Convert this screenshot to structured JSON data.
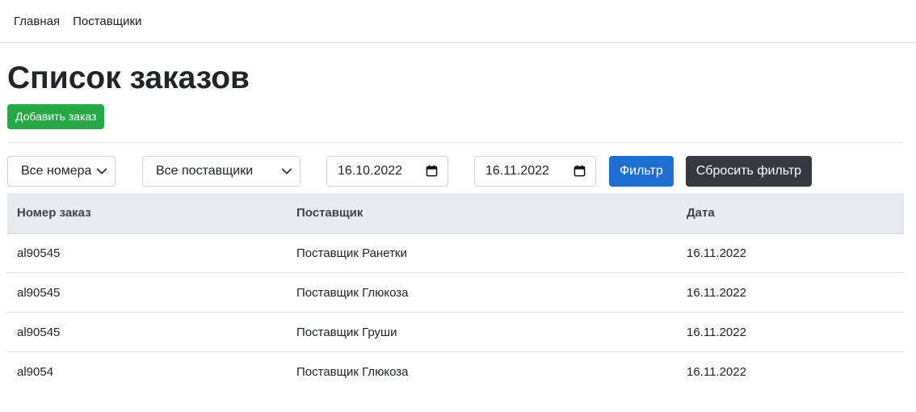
{
  "nav": {
    "home": "Главная",
    "suppliers": "Поставщики"
  },
  "page": {
    "title": "Список заказов",
    "add_button": "Добавить заказ"
  },
  "filters": {
    "number_select": "Все номера",
    "supplier_select": "Все поставщики",
    "date_from": "16.10.2022",
    "date_to": "16.11.2022",
    "filter_button": "Фильтр",
    "reset_button": "Сбросить фильтр"
  },
  "table": {
    "headers": [
      "Номер заказ",
      "Поставщик",
      "Дата"
    ],
    "rows": [
      [
        "al90545",
        "Поставщик Ранетки",
        "16.11.2022"
      ],
      [
        "al90545",
        "Поставщик Глюкоза",
        "16.11.2022"
      ],
      [
        "al90545",
        "Поставщик Груши",
        "16.11.2022"
      ],
      [
        "al9054",
        "Поставщик Глюкоза",
        "16.11.2022"
      ]
    ]
  },
  "colors": {
    "add_button": "#28a745",
    "filter_button": "#1f6fd1",
    "reset_button": "#343a40",
    "table_header_bg": "#e9ecef"
  }
}
